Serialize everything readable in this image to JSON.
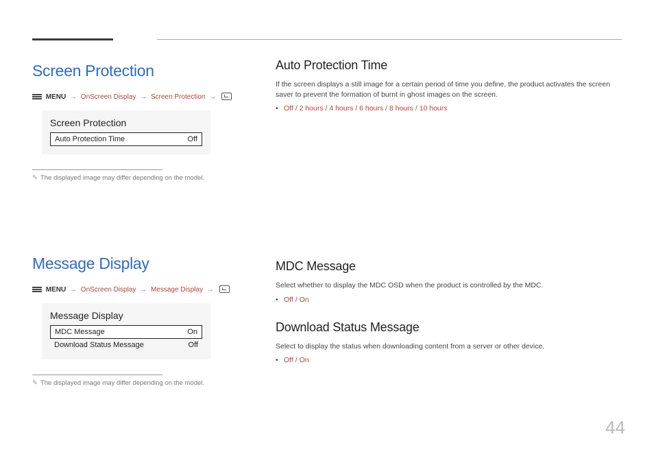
{
  "pageNumber": "44",
  "section1": {
    "heading": "Screen Protection",
    "menuLabel": "MENU",
    "pathParts": [
      "OnScreen Display",
      "Screen Protection"
    ],
    "panelTitle": "Screen Protection",
    "rows": [
      {
        "label": "Auto Protection Time",
        "value": "Off",
        "boxed": true
      }
    ],
    "note": "The displayed image may differ depending on the model."
  },
  "rightA": {
    "heading": "Auto Protection Time",
    "desc": "If the screen displays a still image for a certain period of time you define, the product activates the screen saver to prevent the formation of burnt in ghost images on the screen.",
    "options": "Off / 2 hours / 4 hours / 6 hours / 8 hours / 10 hours"
  },
  "section2": {
    "heading": "Message Display",
    "menuLabel": "MENU",
    "pathParts": [
      "OnScreen Display",
      "Message Display"
    ],
    "panelTitle": "Message Display",
    "rows": [
      {
        "label": "MDC Message",
        "value": "On",
        "boxed": true
      },
      {
        "label": "Download Status Message",
        "value": "Off",
        "boxed": false
      }
    ],
    "note": "The displayed image may differ depending on the model."
  },
  "rightB": {
    "heading": "MDC Message",
    "desc": "Select whether to display the MDC OSD when the product is controlled by the MDC.",
    "options": "Off / On"
  },
  "rightC": {
    "heading": "Download Status Message",
    "desc": "Select to display the status when downloading content from a server or other device.",
    "options": "Off / On"
  }
}
